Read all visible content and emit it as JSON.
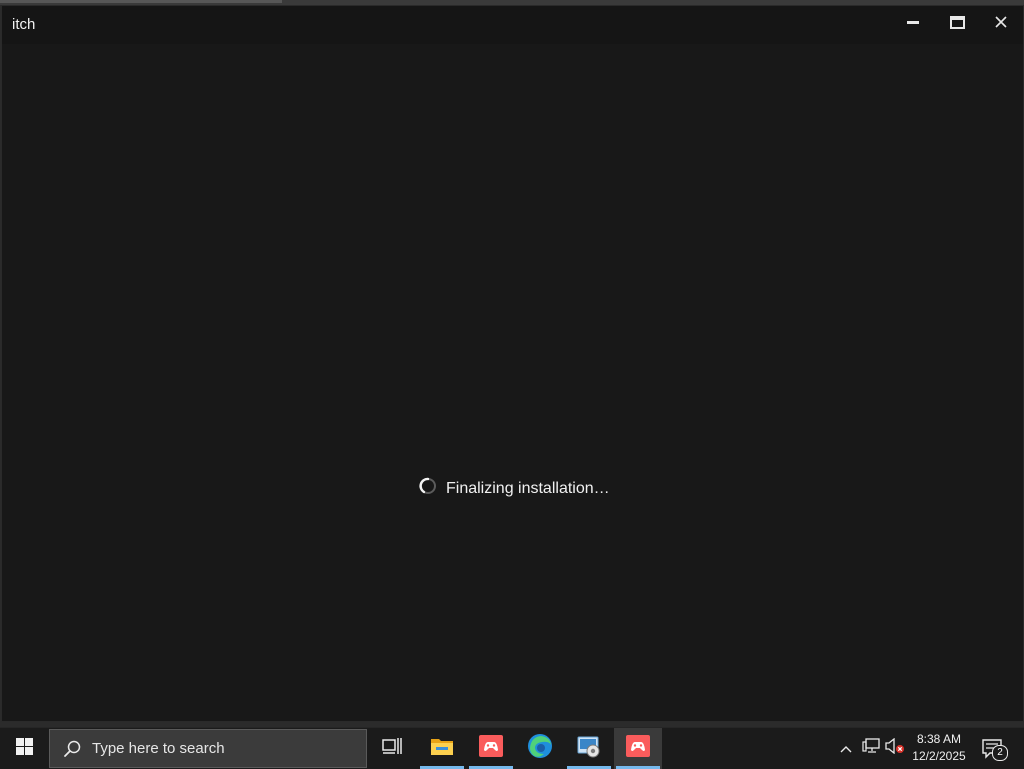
{
  "window": {
    "title": "itch",
    "controls": [
      "minimize-icon",
      "maximize-icon",
      "close-icon"
    ]
  },
  "main": {
    "status_text": "Finalizing installation…",
    "spinner_icon": "loading-spinner-icon"
  },
  "taskbar": {
    "search_placeholder": "Type here to search",
    "pinned": [
      {
        "name": "task-view-icon"
      },
      {
        "name": "file-explorer-icon"
      },
      {
        "name": "itch-app-icon"
      },
      {
        "name": "edge-browser-icon"
      },
      {
        "name": "control-panel-icon"
      },
      {
        "name": "itch-app-icon",
        "active": true
      }
    ],
    "clock": {
      "time": "8:38 AM",
      "date": "12/2/2025"
    },
    "notification_count": "2"
  },
  "colors": {
    "window_bg": "#181818",
    "taskbar_bg": "#1b1b1b",
    "accent_underline": "#76b9ed",
    "itch_red": "#fa5c5c"
  }
}
